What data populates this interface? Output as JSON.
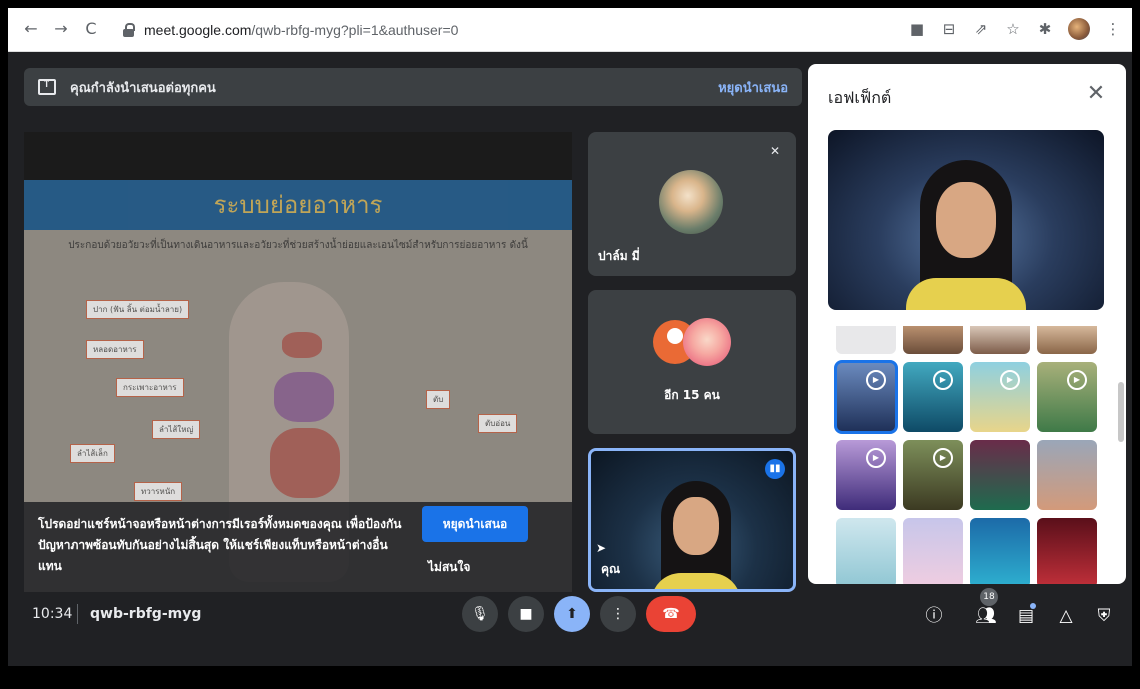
{
  "browser": {
    "url_host": "meet.google.com",
    "url_path": "/qwb-rbfg-myg?pli=1&authuser=0",
    "back_glyph": "←",
    "forward_glyph": "→",
    "reload_glyph": "C",
    "toolbar_icons": [
      "camera-icon",
      "translate-icon",
      "share-icon",
      "star-icon",
      "extensions-icon",
      "profile-avatar",
      "menu-icon"
    ]
  },
  "presentation_banner": {
    "text": "คุณกำลังนำเสนอต่อทุกคน",
    "stop_label": "หยุดนำเสนอ"
  },
  "slide": {
    "title": "ระบบย่อยอาหาร",
    "subtitle": "ประกอบด้วยอวัยวะที่เป็นทางเดินอาหารและอวัยวะที่ช่วยสร้างน้ำย่อยและเอนไซม์สำหรับการย่อยอาหาร ดังนี้",
    "organ_labels": [
      "ปาก (ฟัน ลิ้น ต่อมน้ำลาย)",
      "หลอดอาหาร",
      "กระเพาะอาหาร",
      "ตับ",
      "ตับอ่อน",
      "ลำไส้ใหญ่",
      "ลำไส้เล็ก",
      "ทวารหนัก"
    ]
  },
  "hint": {
    "text": "โปรดอย่าแชร์หน้าจอหรือหน้าต่างการมีเรอร์ทั้งหมดของคุณ เพื่อป้องกันปัญหาภาพซ้อนทับกันอย่างไม่สิ้นสุด ให้แชร์เพียงแท็บหรือหน้าต่างอื่นแทน",
    "stop_label": "หยุดนำเสนอ",
    "dismiss_label": "ไม่สนใจ"
  },
  "tiles": {
    "participant_name": "ปาล์ม มี่",
    "more_label": "อีก 15 คน",
    "self_label": "คุณ"
  },
  "effects": {
    "title": "เอฟเฟ็กต์",
    "close_glyph": "✕"
  },
  "bottom": {
    "time": "10:34",
    "meeting_code": "qwb-rbfg-myg",
    "participant_count": "18"
  }
}
